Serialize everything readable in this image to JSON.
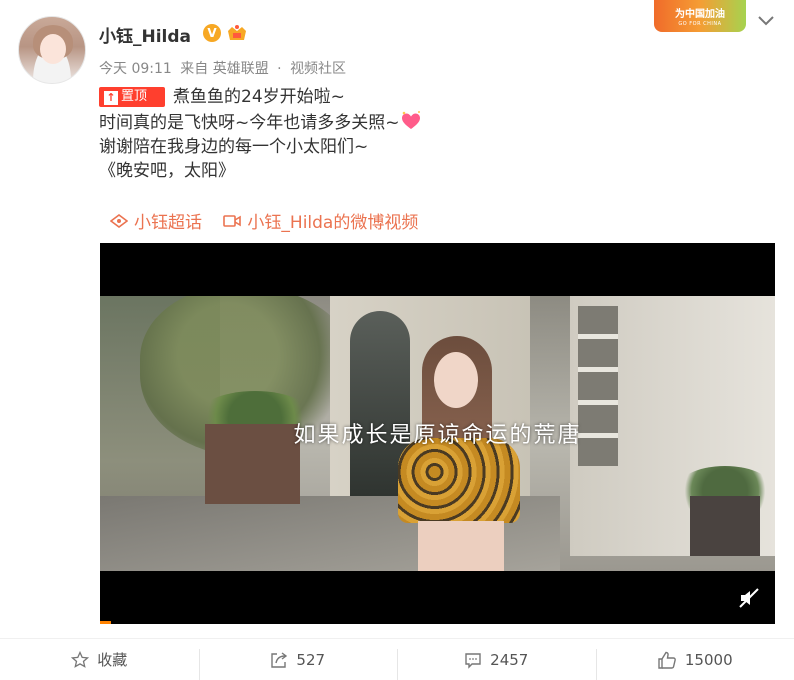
{
  "post": {
    "username": "小钰_Hilda",
    "verified_badge": "V",
    "meta": {
      "time": "今天 09:11",
      "source": "来自 英雄联盟",
      "separator": "·",
      "group": "视频社区"
    },
    "campaign_badge": {
      "label": "为中国加油",
      "sublabel": "GO FOR CHINA"
    },
    "pin_label": "置顶",
    "lines": [
      "煮鱼鱼的24岁开始啦~",
      "时间真的是飞快呀~今年也请多多关照~",
      "谢谢陪在我身边的每一个小太阳们~",
      "《晚安吧，太阳》"
    ],
    "links": {
      "supertopic": "小钰超话",
      "video_channel": "小钰_Hilda的微博视频"
    },
    "video": {
      "subtitle": "如果成长是原谅命运的荒唐",
      "progress": 0.016,
      "muted": true
    }
  },
  "actions": {
    "favorite": "收藏",
    "repost": "527",
    "comment": "2457",
    "like": "15000"
  },
  "colors": {
    "link": "#eb7350",
    "pin": "#ff3f2e",
    "verified": "#f7a824",
    "progress": "#ff8200"
  },
  "icons": {
    "pin": "pin-icon",
    "heart": "heart-sparkle-icon",
    "supertopic": "supertopic-icon",
    "video_channel": "video-camera-icon",
    "mute": "mute-icon",
    "favorite": "star-icon",
    "repost": "repost-icon",
    "comment": "comment-icon",
    "like": "thumbs-up-icon",
    "more": "chevron-down-icon"
  }
}
